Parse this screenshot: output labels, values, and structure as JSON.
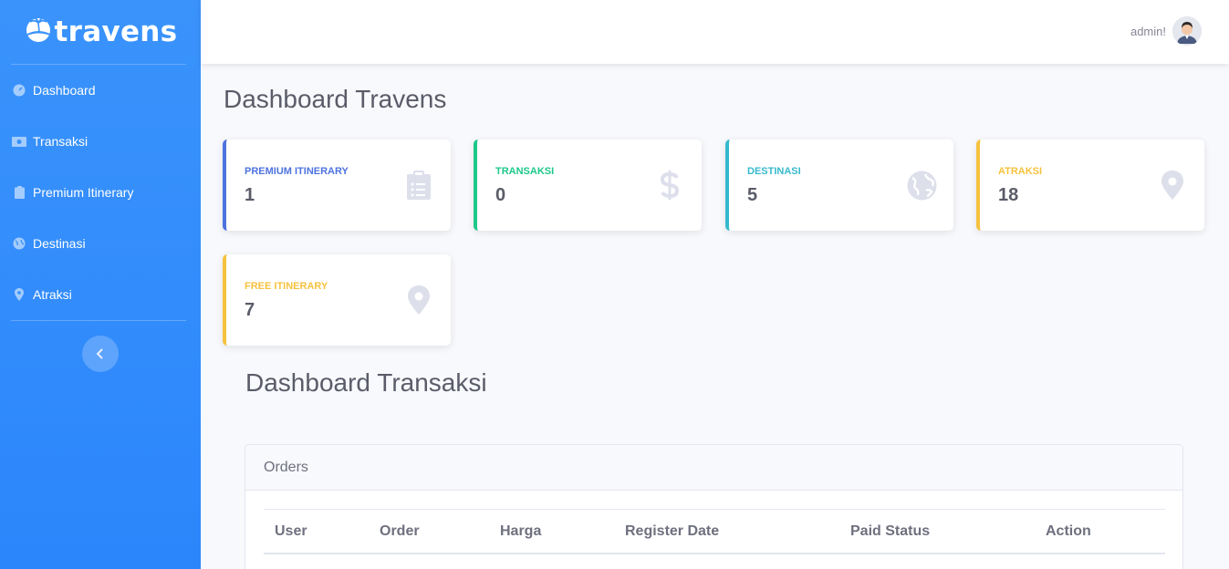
{
  "brand": {
    "name": "travens",
    "logo_icon": "palm-sun-logo"
  },
  "sidebar": {
    "items": [
      {
        "label": "Dashboard",
        "icon": "gauge-icon"
      },
      {
        "label": "Transaksi",
        "icon": "money-bill-icon"
      },
      {
        "label": "Premium Itinerary",
        "icon": "clipboard-icon"
      },
      {
        "label": "Destinasi",
        "icon": "globe-icon"
      },
      {
        "label": "Atraksi",
        "icon": "map-marker-icon"
      }
    ],
    "toggle_icon": "chevron-left-icon"
  },
  "topbar": {
    "user_name": "admin!",
    "avatar_icon": "user-avatar"
  },
  "page": {
    "title": "Dashboard Travens"
  },
  "cards": [
    {
      "label": "PREMIUM ITINERARY",
      "value": "1",
      "color": "#4e73df",
      "icon": "clipboard-list-icon"
    },
    {
      "label": "TRANSAKSI",
      "value": "0",
      "color": "#1cc88a",
      "icon": "dollar-icon"
    },
    {
      "label": "DESTINASI",
      "value": "5",
      "color": "#36b9cc",
      "icon": "globe-icon"
    },
    {
      "label": "ATRAKSI",
      "value": "18",
      "color": "#f6c23e",
      "icon": "map-marker-icon"
    },
    {
      "label": "FREE ITINERARY",
      "value": "7",
      "color": "#f6c23e",
      "icon": "map-marker-icon"
    }
  ],
  "transactions": {
    "title": "Dashboard Transaksi",
    "panel_title": "Orders",
    "columns": [
      "User",
      "Order",
      "Harga",
      "Register Date",
      "Paid Status",
      "Action"
    ]
  }
}
